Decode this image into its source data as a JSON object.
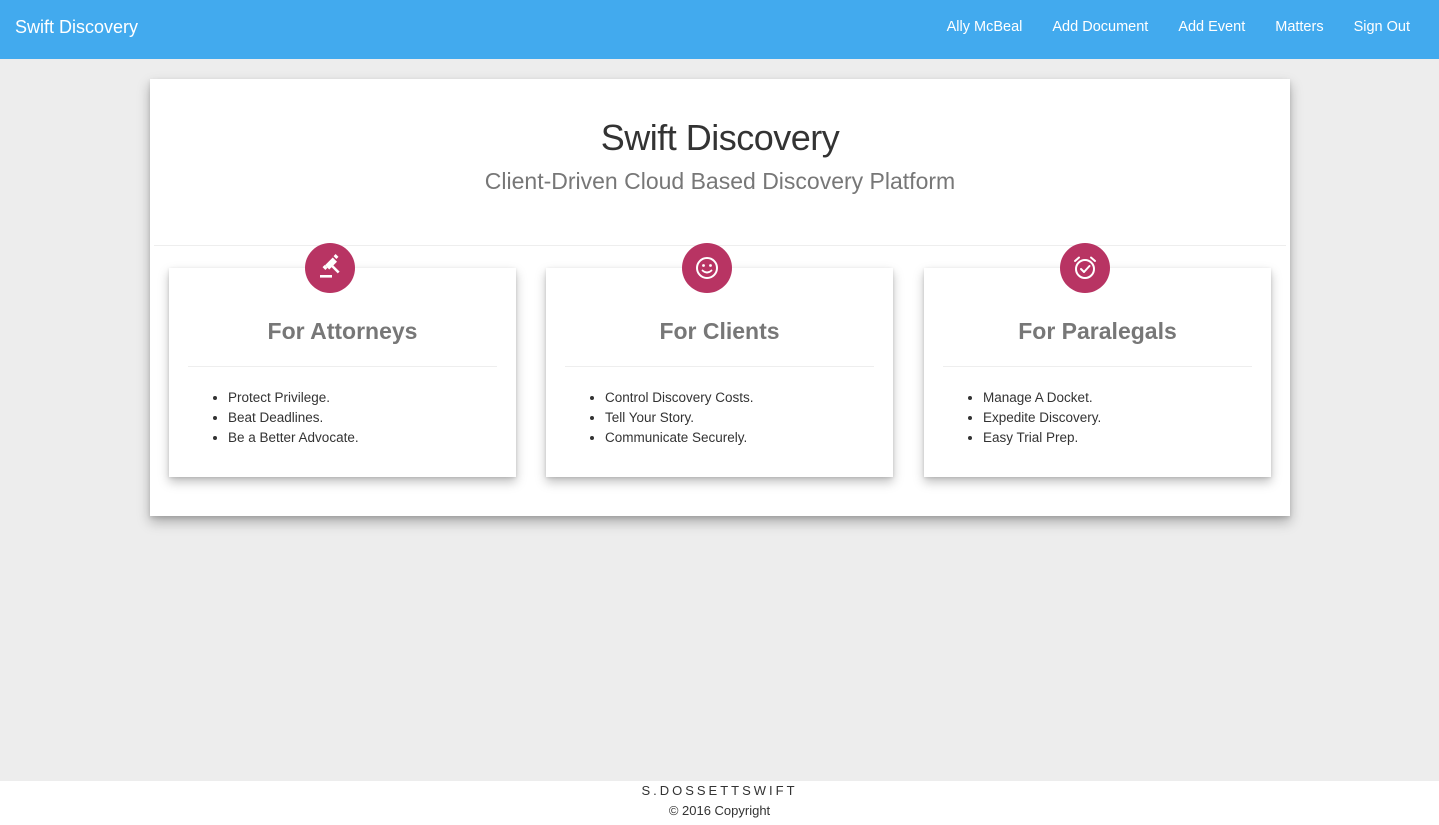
{
  "nav": {
    "brand": "Swift Discovery",
    "links": [
      "Ally McBeal",
      "Add Document",
      "Add Event",
      "Matters",
      "Sign Out"
    ]
  },
  "hero": {
    "title": "Swift Discovery",
    "subtitle": "Client-Driven Cloud Based Discovery Platform"
  },
  "cards": [
    {
      "icon": "gavel-icon",
      "title": "For Attorneys",
      "items": [
        "Protect Privilege.",
        "Beat Deadlines.",
        "Be a Better Advocate."
      ]
    },
    {
      "icon": "smiley-face-icon",
      "title": "For Clients",
      "items": [
        "Control Discovery Costs.",
        "Tell Your Story.",
        "Communicate Securely."
      ]
    },
    {
      "icon": "alarm-clock-check-icon",
      "title": "For Paralegals",
      "items": [
        "Manage A Docket.",
        "Expedite Discovery.",
        "Easy Trial Prep."
      ]
    }
  ],
  "footer": {
    "brand": "S.DOSSETTSWIFT",
    "copyright": "© 2016 Copyright"
  },
  "colors": {
    "navbar": "#42aaee",
    "accent": "#b83463",
    "background": "#ededed"
  }
}
